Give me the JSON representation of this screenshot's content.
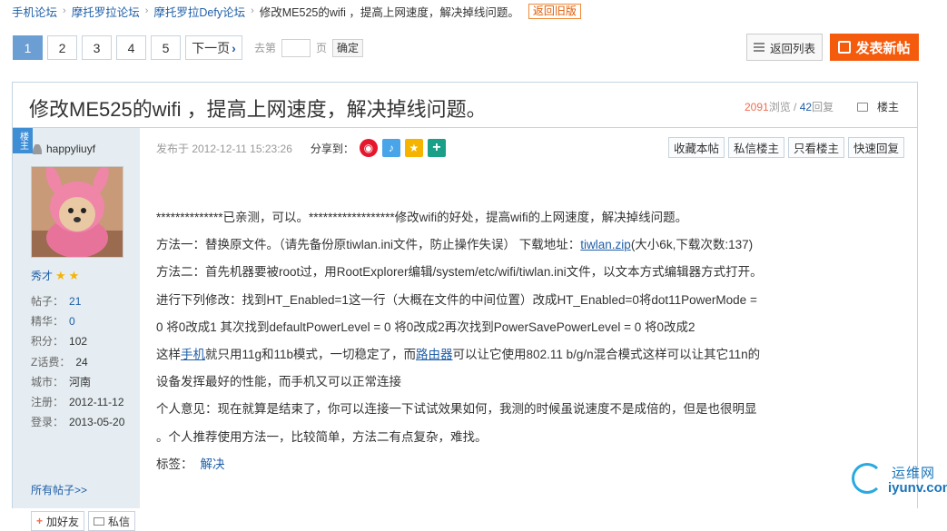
{
  "breadcrumb": {
    "items": [
      "手机论坛",
      "摩托罗拉论坛",
      "摩托罗拉Defy论坛"
    ],
    "current": "修改ME525的wifi ，提高上网速度，解决掉线问题。",
    "old_version": "返回旧版",
    "sep": "›"
  },
  "pager": {
    "pages": [
      "1",
      "2",
      "3",
      "4",
      "5"
    ],
    "next": "下一页",
    "goto_prefix": "去第",
    "goto_suffix": "页",
    "confirm": "确定"
  },
  "toolbar": {
    "back_list": "返回列表",
    "new_post": "发表新帖"
  },
  "thread": {
    "title": "修改ME525的wifi ，提高上网速度，解决掉线问题。",
    "views": "2091",
    "views_label": "浏览",
    "slash": " / ",
    "replies": "42",
    "replies_label": "回复",
    "louzhu": "楼主"
  },
  "author": {
    "badge": "楼主",
    "name": "happyliuyf",
    "rank": "秀才",
    "stats": [
      {
        "label": "帖子：",
        "value": "21",
        "link": true
      },
      {
        "label": "精华：",
        "value": "0",
        "link": true
      },
      {
        "label": "积分：",
        "value": "102",
        "link": false
      },
      {
        "label": "Z话费：",
        "value": "24",
        "link": false
      },
      {
        "label": "城市：",
        "value": "河南",
        "link": false
      },
      {
        "label": "注册：",
        "value": "2012-11-12",
        "link": false
      },
      {
        "label": "登录：",
        "value": "2013-05-20",
        "link": false
      }
    ],
    "all_posts": "所有帖子>>",
    "add_friend": "加好友",
    "message": "私信"
  },
  "post": {
    "posted": "发布于 2012-12-11 15:23:26",
    "share_label": "分享到：",
    "buttons": [
      "收藏本帖",
      "私信楼主",
      "只看楼主",
      "快速回复"
    ],
    "line1": "**************已亲测，可以。******************修改wifi的好处，提高wifi的上网速度，解决掉线问题。",
    "line2_a": "方法一：替换原文件。（请先备份原tiwlan.ini文件，防止操作失误）   下载地址：",
    "line2_link": "tiwlan.zip",
    "line2_b": "(大小6k,下载次数:137)",
    "line3": "方法二：首先机器要被root过，用RootExplorer编辑/system/etc/wifi/tiwlan.ini文件，以文本方式编辑器方式打开。",
    "line4": "进行下列修改：找到HT_Enabled=1这一行（大概在文件的中间位置）改成HT_Enabled=0将dot11PowerMode =",
    "line5": "0 将0改成1 其次找到defaultPowerLevel = 0 将0改成2再次找到PowerSavePowerLevel = 0 将0改成2",
    "line6_a": "这样",
    "line6_link1": "手机",
    "line6_b": "就只用11g和11b模式，一切稳定了，而",
    "line6_link2": "路由器",
    "line6_c": "可以让它使用802.11 b/g/n混合模式这样可以让其它11n的",
    "line7": "设备发挥最好的性能，而手机又可以正常连接",
    "line8": "个人意见：现在就算是结束了，你可以连接一下试试效果如何，我测的时候虽说速度不是成倍的，但是也很明显",
    "line9": "。个人推荐使用方法一，比较简单，方法二有点复杂，难找。",
    "tag_label": "标签：",
    "tag": "解决"
  },
  "watermark": {
    "cn": "运维网",
    "en": "iyunv.com"
  }
}
